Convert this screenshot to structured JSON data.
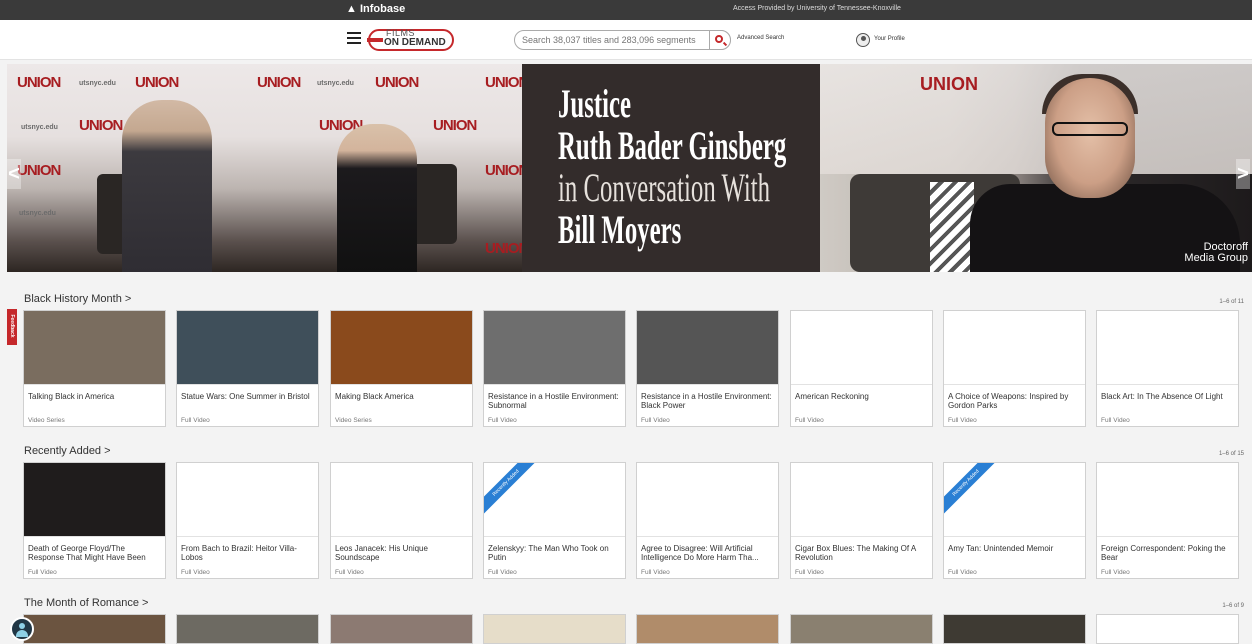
{
  "topbar": {
    "brand": "Infobase",
    "access_text": "Access Provided by University of Tennessee-Knoxville"
  },
  "header": {
    "logo_top": "FILMS",
    "logo_bottom": "ON DEMAND",
    "search_placeholder": "Search 38,037 titles and 283,096 segments",
    "advanced_search": "Advanced Search",
    "profile": "Your Profile"
  },
  "banner": {
    "line1": "Justice",
    "line2": "Ruth Bader Ginsberg",
    "line3": "in Conversation With",
    "line4": "Bill Moyers",
    "credit_line1": "Doctoroff",
    "credit_line2": "Media Group",
    "prev": "<",
    "next": ">",
    "wall_union": "UNION",
    "wall_site": "utsnyc.edu"
  },
  "feedback": "Feedback",
  "sections": [
    {
      "title": "Black History Month >",
      "count": "1–6 of 11",
      "cards": [
        {
          "name": "Talking Black in America",
          "kind": "Video Series",
          "thumb": "#7a6d5f"
        },
        {
          "name": "Statue Wars: One Summer in Bristol",
          "kind": "Full Video",
          "thumb": "#3f4f5a"
        },
        {
          "name": "Making Black America",
          "kind": "Video Series",
          "thumb": "#8a4a1c"
        },
        {
          "name": "Resistance in a Hostile Environment: Subnormal",
          "kind": "Full Video",
          "thumb": "#6e6e6e"
        },
        {
          "name": "Resistance in a Hostile Environment: Black Power",
          "kind": "Full Video",
          "thumb": "#555555"
        },
        {
          "name": "American Reckoning",
          "kind": "Full Video",
          "thumb": "#ffffff"
        },
        {
          "name": "A Choice of Weapons: Inspired by Gordon Parks",
          "kind": "Full Video",
          "thumb": "#ffffff"
        },
        {
          "name": "Black Art: In The Absence Of Light",
          "kind": "Full Video",
          "thumb": "#ffffff"
        }
      ]
    },
    {
      "title": "Recently Added >",
      "count": "1–6 of 15",
      "ribbon": "Recently Added",
      "cards": [
        {
          "name": "Death of George Floyd/The Response That Might Have Been",
          "kind": "Full Video",
          "thumb": "#1f1c1c"
        },
        {
          "name": "From Bach to Brazil: Heitor Villa-Lobos",
          "kind": "Full Video",
          "thumb": "#ffffff"
        },
        {
          "name": "Leos Janacek: His Unique Soundscape",
          "kind": "Full Video",
          "thumb": "#ffffff"
        },
        {
          "name": "Zelenskyy: The Man Who Took on Putin",
          "kind": "Full Video",
          "thumb": "#ffffff",
          "ribbon": true
        },
        {
          "name": "Agree to Disagree: Will Artificial Intelligence Do More Harm Tha...",
          "kind": "Full Video",
          "thumb": "#ffffff"
        },
        {
          "name": "Cigar Box Blues: The Making Of A Revolution",
          "kind": "Full Video",
          "thumb": "#ffffff"
        },
        {
          "name": "Amy Tan: Unintended Memoir",
          "kind": "Full Video",
          "thumb": "#ffffff",
          "ribbon": true
        },
        {
          "name": "Foreign Correspondent: Poking the Bear",
          "kind": "Full Video",
          "thumb": "#ffffff"
        }
      ]
    },
    {
      "title": "The Month of Romance >",
      "count": "1–6 of 9",
      "cards": [
        {
          "thumb": "#6b5440"
        },
        {
          "thumb": "#6d6a62"
        },
        {
          "thumb": "#8c7a72"
        },
        {
          "thumb": "#e6ddc9"
        },
        {
          "thumb": "#b08c6a"
        },
        {
          "thumb": "#8a8070"
        },
        {
          "thumb": "#3e3a33"
        },
        {
          "thumb": "#ffffff"
        }
      ]
    }
  ]
}
